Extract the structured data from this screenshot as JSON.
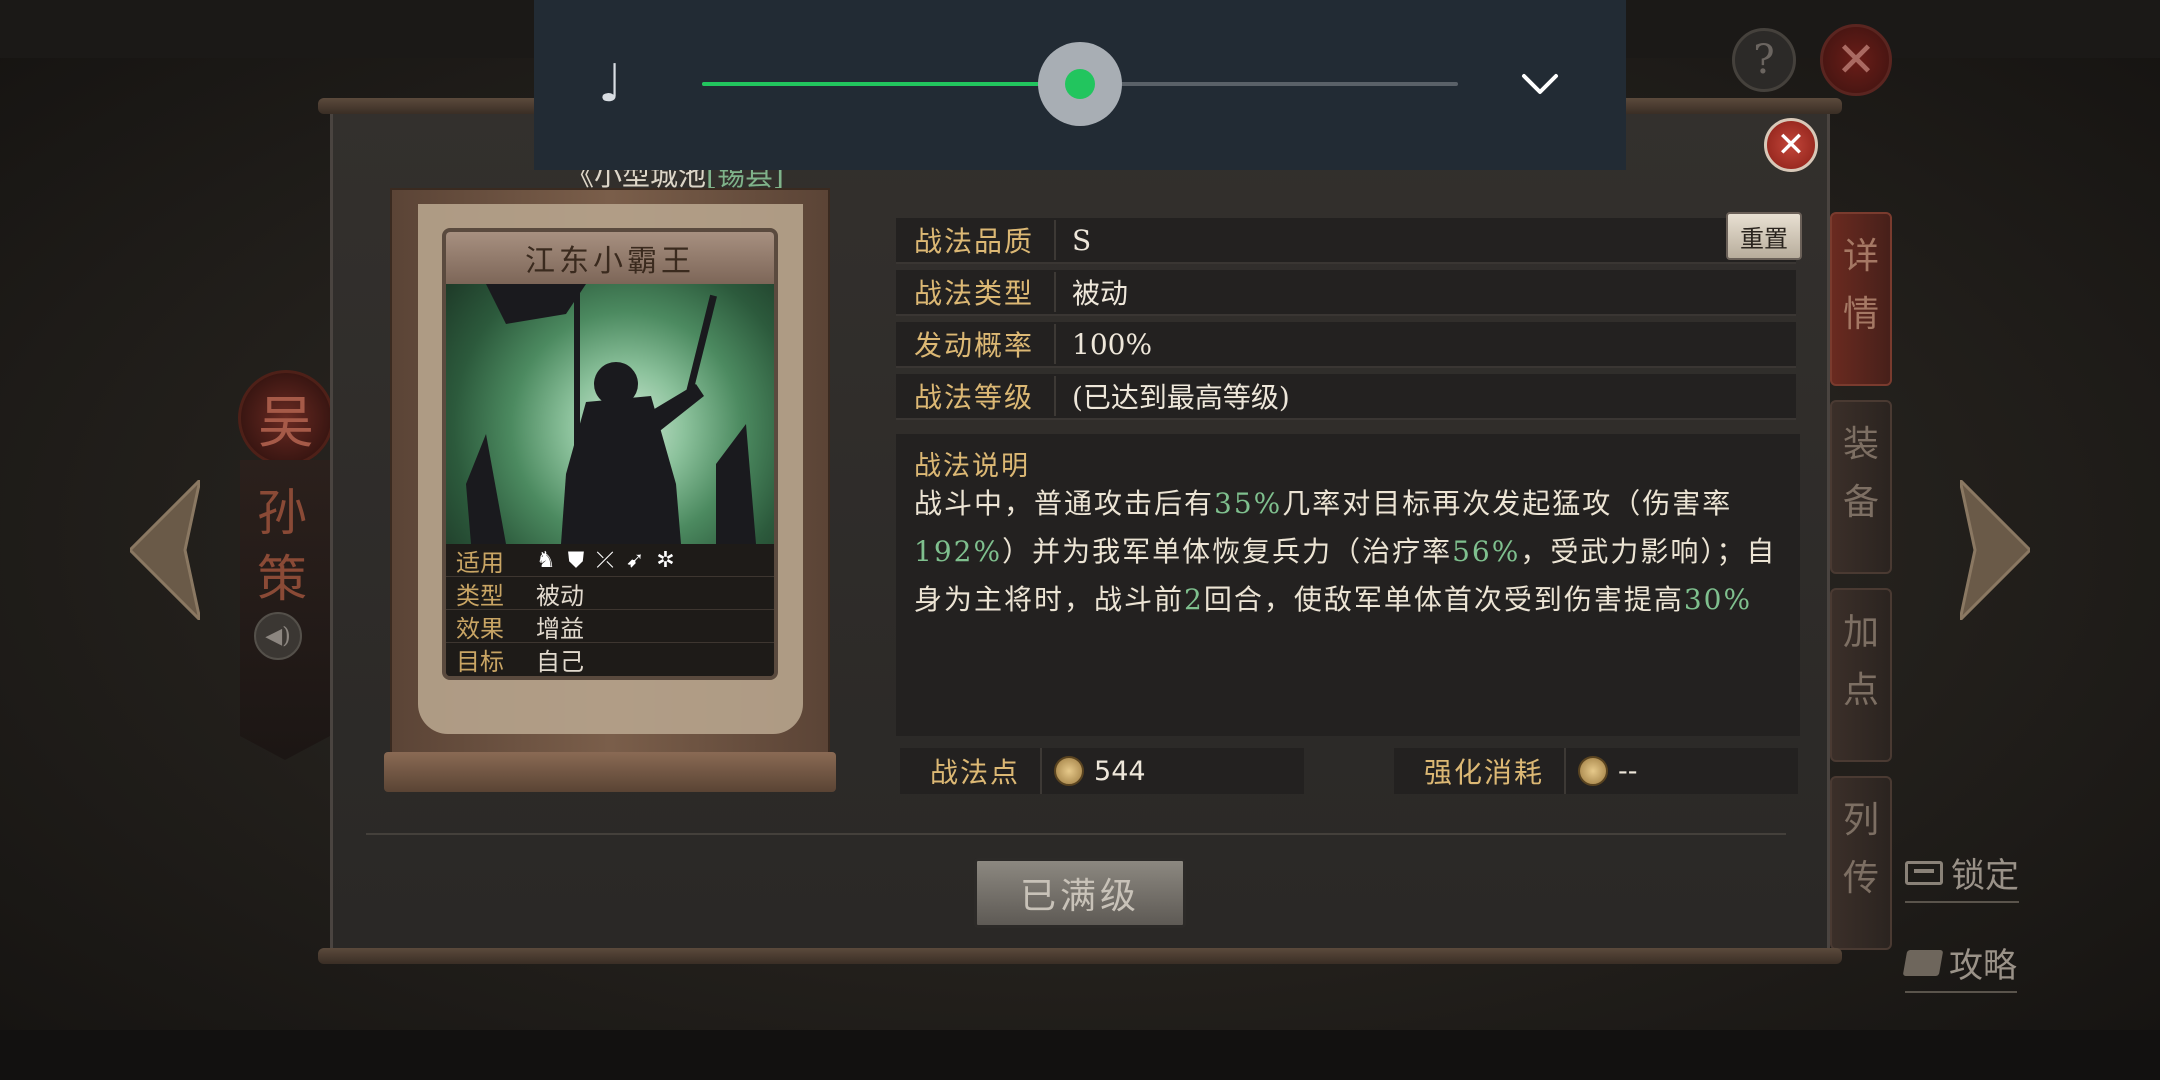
{
  "background": {
    "faction_seal": "吴",
    "general_name": "孙策",
    "side_tabs": [
      "详情",
      "装备",
      "加点",
      "列传"
    ],
    "lock_label": "锁定",
    "guide_label": "攻略",
    "help_glyph": "?",
    "close_glyph": "✕"
  },
  "dialog": {
    "close_glyph": "✕",
    "city_prefix": "《小型城池",
    "city_tag": "[锡县]",
    "card": {
      "title": "江东小霸王",
      "rows": [
        {
          "key": "适用",
          "value": ""
        },
        {
          "key": "类型",
          "value": "被动"
        },
        {
          "key": "效果",
          "value": "增益"
        },
        {
          "key": "目标",
          "value": "自己"
        }
      ],
      "troop_icons": [
        "cavalry-icon",
        "shield-icon",
        "bow-icon",
        "spear-icon",
        "wheel-icon"
      ]
    },
    "fields": [
      {
        "key": "战法品质",
        "value": "S"
      },
      {
        "key": "战法类型",
        "value": "被动"
      },
      {
        "key": "发动概率",
        "value": "100%"
      },
      {
        "key": "战法等级",
        "value": "(已达到最高等级)"
      }
    ],
    "reset_label": "重置",
    "description": {
      "title": "战法说明",
      "segments": [
        {
          "text": "战斗中，普通攻击后有",
          "hl": false
        },
        {
          "text": "35%",
          "hl": true
        },
        {
          "text": "几率对目标再次发起猛攻（伤害率",
          "hl": false
        },
        {
          "text": "192%",
          "hl": true
        },
        {
          "text": "）并为我军单体恢复兵力（治疗率",
          "hl": false
        },
        {
          "text": "56%",
          "hl": true
        },
        {
          "text": "，受武力影响）；自身为主将时，战斗前",
          "hl": false
        },
        {
          "text": "2",
          "hl": true
        },
        {
          "text": "回合，使敌军单体首次受到伤害提高",
          "hl": false
        },
        {
          "text": "30%",
          "hl": true
        }
      ]
    },
    "points": {
      "label": "战法点",
      "value": "544"
    },
    "cost": {
      "label": "强化消耗",
      "value": "--"
    },
    "maxed_label": "已满级"
  },
  "media": {
    "icon": "music-note-icon",
    "volume_fraction": 0.5,
    "accent": "#22c55e"
  }
}
